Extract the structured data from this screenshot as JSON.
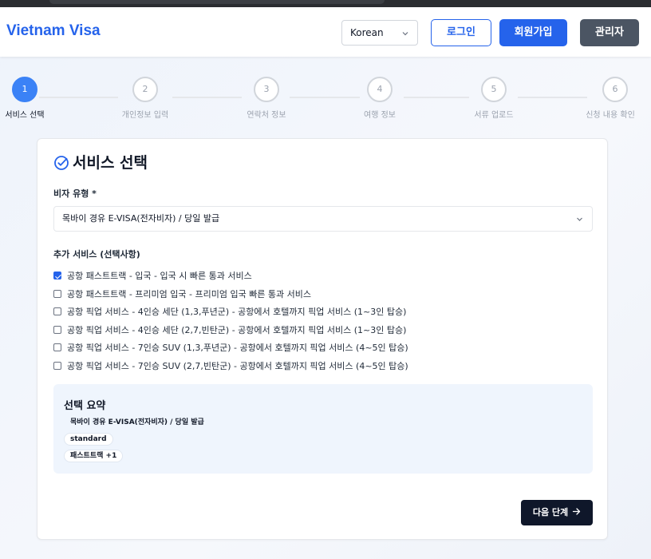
{
  "header": {
    "brand": "Vietnam Visa",
    "language": "Korean",
    "login_label": "로그인",
    "signup_label": "회원가입",
    "admin_label": "관리자"
  },
  "steps": [
    {
      "number": "1",
      "label": "서비스 선택",
      "active": true
    },
    {
      "number": "2",
      "label": "개인정보 입력",
      "active": false
    },
    {
      "number": "3",
      "label": "연락처 정보",
      "active": false
    },
    {
      "number": "4",
      "label": "여행 정보",
      "active": false
    },
    {
      "number": "5",
      "label": "서류 업로드",
      "active": false
    },
    {
      "number": "6",
      "label": "신청 내용 확인",
      "active": false
    }
  ],
  "card": {
    "title": "서비스 선택",
    "visa_type_label": "비자 유형 *",
    "visa_type_value": "목바이 경유 E-VISA(전자비자) / 당일 발급",
    "extra_services_label": "추가 서비스 (선택사항)",
    "extra_services": [
      {
        "label": "공항 패스트트랙 - 입국 - 입국 시 빠른 통과 서비스",
        "checked": true
      },
      {
        "label": "공항 패스트트랙 - 프리미엄 입국 - 프리미엄 입국 빠른 통과 서비스",
        "checked": false
      },
      {
        "label": "공항 픽업 서비스 - 4인승 세단 (1,3,푸년군) - 공항에서 호텔까지 픽업 서비스 (1~3인 탑승)",
        "checked": false
      },
      {
        "label": "공항 픽업 서비스 - 4인승 세단 (2,7,빈탄군) - 공항에서 호텔까지 픽업 서비스 (1~3인 탑승)",
        "checked": false
      },
      {
        "label": "공항 픽업 서비스 - 7인승 SUV (1,3,푸년군) - 공항에서 호텔까지 픽업 서비스 (4~5인 탑승)",
        "checked": false
      },
      {
        "label": "공항 픽업 서비스 - 7인승 SUV (2,7,빈탄군) - 공항에서 호텔까지 픽업 서비스 (4~5인 탑승)",
        "checked": false
      }
    ],
    "summary": {
      "title": "선택 요약",
      "visa": "목바이 경유 E-VISA(전자비자) / 당일 발급",
      "processing": "standard",
      "extras": "패스트트랙 +1"
    },
    "next_label": "다음 단계"
  },
  "colors": {
    "accent": "#2563eb",
    "active_step": "#3b82f6",
    "admin": "#4b5563",
    "next_button": "#0f172a",
    "summary_bg": "#eff5fd"
  }
}
